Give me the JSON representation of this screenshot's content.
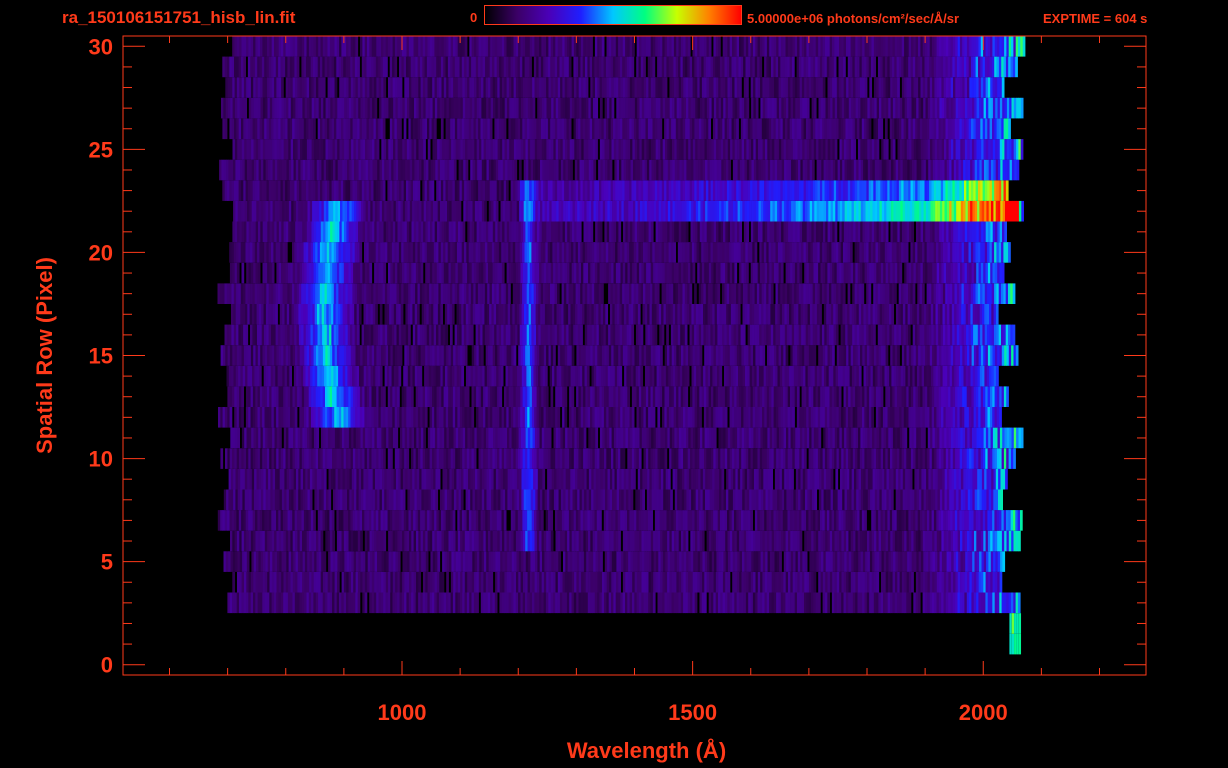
{
  "header": {
    "file_title": "ra_150106151751_hisb_lin.fit",
    "colorbar_min": "0",
    "colorbar_max": "5.00000e+06 photons/cm²/sec/Å/sr",
    "exptime": "EXPTIME = 604 s"
  },
  "colors": {
    "axis": "#ff3a1a",
    "background": "#000000",
    "colormap": [
      "#000000",
      "#3b0066",
      "#4a00b8",
      "#1f1fff",
      "#00c8ff",
      "#00ff80",
      "#c8ff00",
      "#ff8000",
      "#ff0000"
    ]
  },
  "chart_data": {
    "type": "heatmap",
    "title": "",
    "xlabel": "Wavelength (Å)",
    "ylabel": "Spatial Row (Pixel)",
    "xlim": [
      520,
      2280
    ],
    "ylim": [
      -0.5,
      30.5
    ],
    "x_ticks": [
      1000,
      1500,
      2000
    ],
    "y_ticks": [
      0,
      5,
      10,
      15,
      20,
      25,
      30
    ],
    "colorbar_range": [
      0,
      5000000
    ],
    "colorbar_units": "photons/cm²/sec/Å/sr",
    "data_extent": {
      "x": [
        690,
        2080
      ],
      "y": [
        3,
        30
      ]
    },
    "features": [
      {
        "name": "Lyman beta / O VI arc",
        "x_center": 880,
        "rows": [
          12,
          22
        ],
        "peak_fraction": 0.45
      },
      {
        "name": "Lyman alpha column",
        "x_center": 1216,
        "rows": [
          6,
          23
        ],
        "peak_fraction": 0.35
      },
      {
        "name": "row 22-23 continuum",
        "x": [
          1200,
          2060
        ],
        "rows": [
          22,
          23
        ],
        "peak_fraction": 0.65
      },
      {
        "name": "red-end noise band",
        "x": [
          1900,
          2080
        ],
        "rows": [
          1,
          30
        ],
        "peak_fraction": 0.6
      }
    ]
  }
}
